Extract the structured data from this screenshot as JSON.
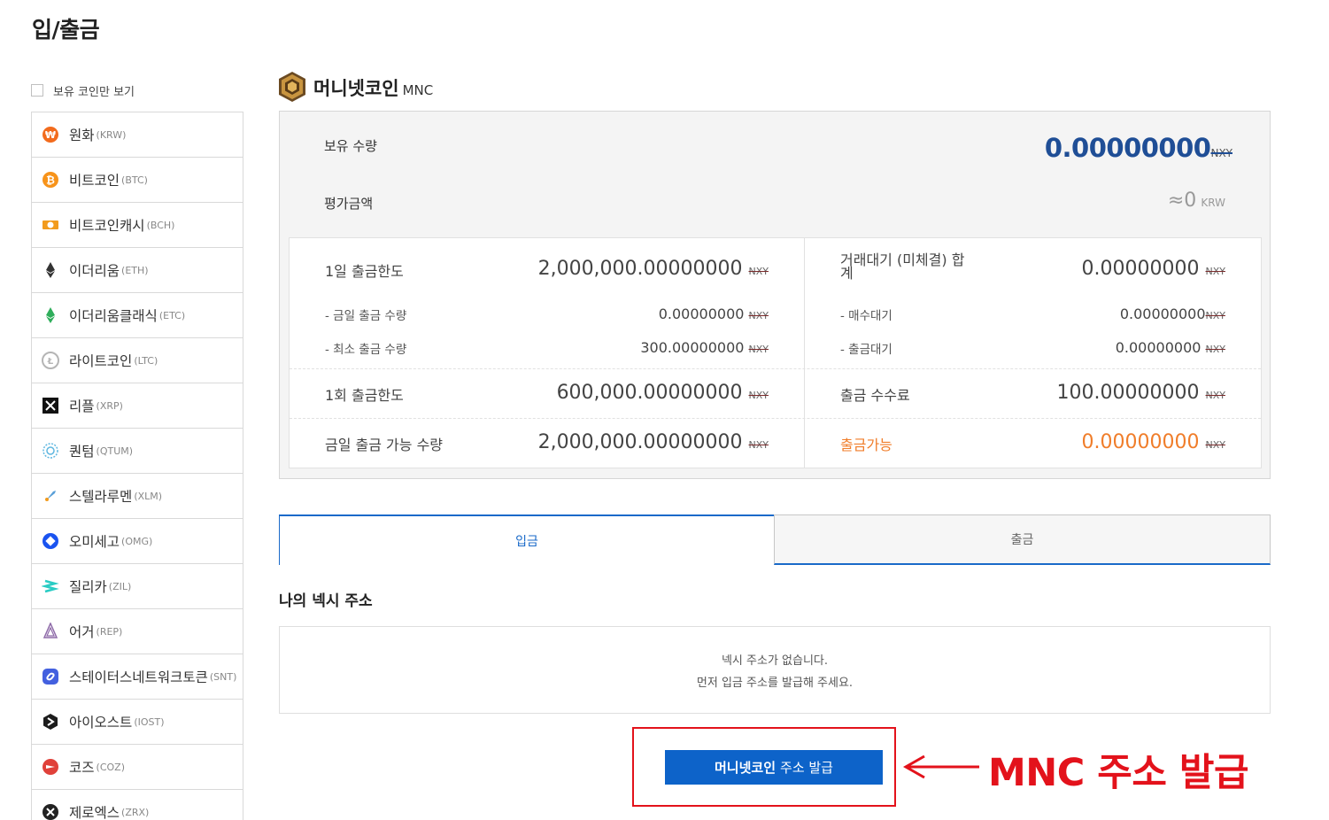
{
  "page_title": "입/출금",
  "sidebar": {
    "only_held_label": "보유 코인만 보기",
    "coins": [
      {
        "name": "원화",
        "symbol": "(KRW)",
        "icon": "won-icon",
        "color": "#f26b1d"
      },
      {
        "name": "비트코인",
        "symbol": "(BTC)",
        "icon": "bitcoin-icon",
        "color": "#f7931a"
      },
      {
        "name": "비트코인캐시",
        "symbol": "(BCH)",
        "icon": "bitcoin-cash-icon",
        "color": "#f29b1d"
      },
      {
        "name": "이더리움",
        "symbol": "(ETH)",
        "icon": "ethereum-icon",
        "color": "#333333"
      },
      {
        "name": "이더리움클래식",
        "symbol": "(ETC)",
        "icon": "ethereum-classic-icon",
        "color": "#2fae5b"
      },
      {
        "name": "라이트코인",
        "symbol": "(LTC)",
        "icon": "litecoin-icon",
        "color": "#b5b5b5"
      },
      {
        "name": "리플",
        "symbol": "(XRP)",
        "icon": "xrp-icon",
        "color": "#111111"
      },
      {
        "name": "퀀텀",
        "symbol": "(QTUM)",
        "icon": "qtum-icon",
        "color": "#5fb7e0"
      },
      {
        "name": "스텔라루멘",
        "symbol": "(XLM)",
        "icon": "stellar-rocket-icon",
        "color": "#5aa0d8"
      },
      {
        "name": "오미세고",
        "symbol": "(OMG)",
        "icon": "omisego-icon",
        "color": "#1a53f0"
      },
      {
        "name": "질리카",
        "symbol": "(ZIL)",
        "icon": "zilliqa-icon",
        "color": "#29ccc4"
      },
      {
        "name": "어거",
        "symbol": "(REP)",
        "icon": "augur-icon",
        "color": "#8e6aa8"
      },
      {
        "name": "스테이터스네트워크토큰",
        "symbol": "(SNT)",
        "icon": "status-icon",
        "color": "#4360df"
      },
      {
        "name": "아이오스트",
        "symbol": "(IOST)",
        "icon": "iost-icon",
        "color": "#1c1c1c"
      },
      {
        "name": "코즈",
        "symbol": "(COZ)",
        "icon": "coz-icon",
        "color": "#e0413a"
      },
      {
        "name": "제로엑스",
        "symbol": "(ZRX)",
        "icon": "zrx-icon",
        "color": "#222222"
      }
    ]
  },
  "coin": {
    "name": "머니넷코인",
    "symbol": "MNC",
    "logo_icon": "moneynet-coin-logo-icon",
    "unit": "NXY"
  },
  "summary": {
    "holding_label": "보유 수량",
    "holding_value": "0.00000000",
    "valuation_label": "평가금액",
    "valuation_value": "≈0",
    "valuation_unit": "KRW"
  },
  "limits": {
    "daily_limit_label": "1일 출금한도",
    "daily_limit_value": "2,000,000.00000000",
    "today_withdrawn_label": "- 금일 출금 수량",
    "today_withdrawn_value": "0.00000000",
    "min_withdraw_label": "- 최소 출금 수량",
    "min_withdraw_value": "300.00000000",
    "once_limit_label": "1회 출금한도",
    "once_limit_value": "600,000.00000000",
    "available_today_label": "금일 출금 가능 수량",
    "available_today_value": "2,000,000.00000000",
    "pending_total_label_line1": "거래대기 (미체결) 합",
    "pending_total_label_line2": "계",
    "pending_total_value": "0.00000000",
    "pending_buy_label": "- 매수대기",
    "pending_buy_value": "0.00000000",
    "pending_withdraw_label": "- 출금대기",
    "pending_withdraw_value": "0.00000000",
    "fee_label": "출금 수수료",
    "fee_value": "100.00000000",
    "withdrawable_label": "출금가능",
    "withdrawable_value": "0.00000000"
  },
  "tabs": {
    "deposit": "입금",
    "withdraw": "출금"
  },
  "address": {
    "title": "나의 넥시 주소",
    "empty_line1": "넥시 주소가 없습니다.",
    "empty_line2": "먼저 입금 주소를 발급해 주세요."
  },
  "issue_button": {
    "coin_label": "머니넷코인",
    "action_label": "주소 발급"
  },
  "annotation": {
    "text": "MNC 주소 발급",
    "color": "#e3121b"
  }
}
